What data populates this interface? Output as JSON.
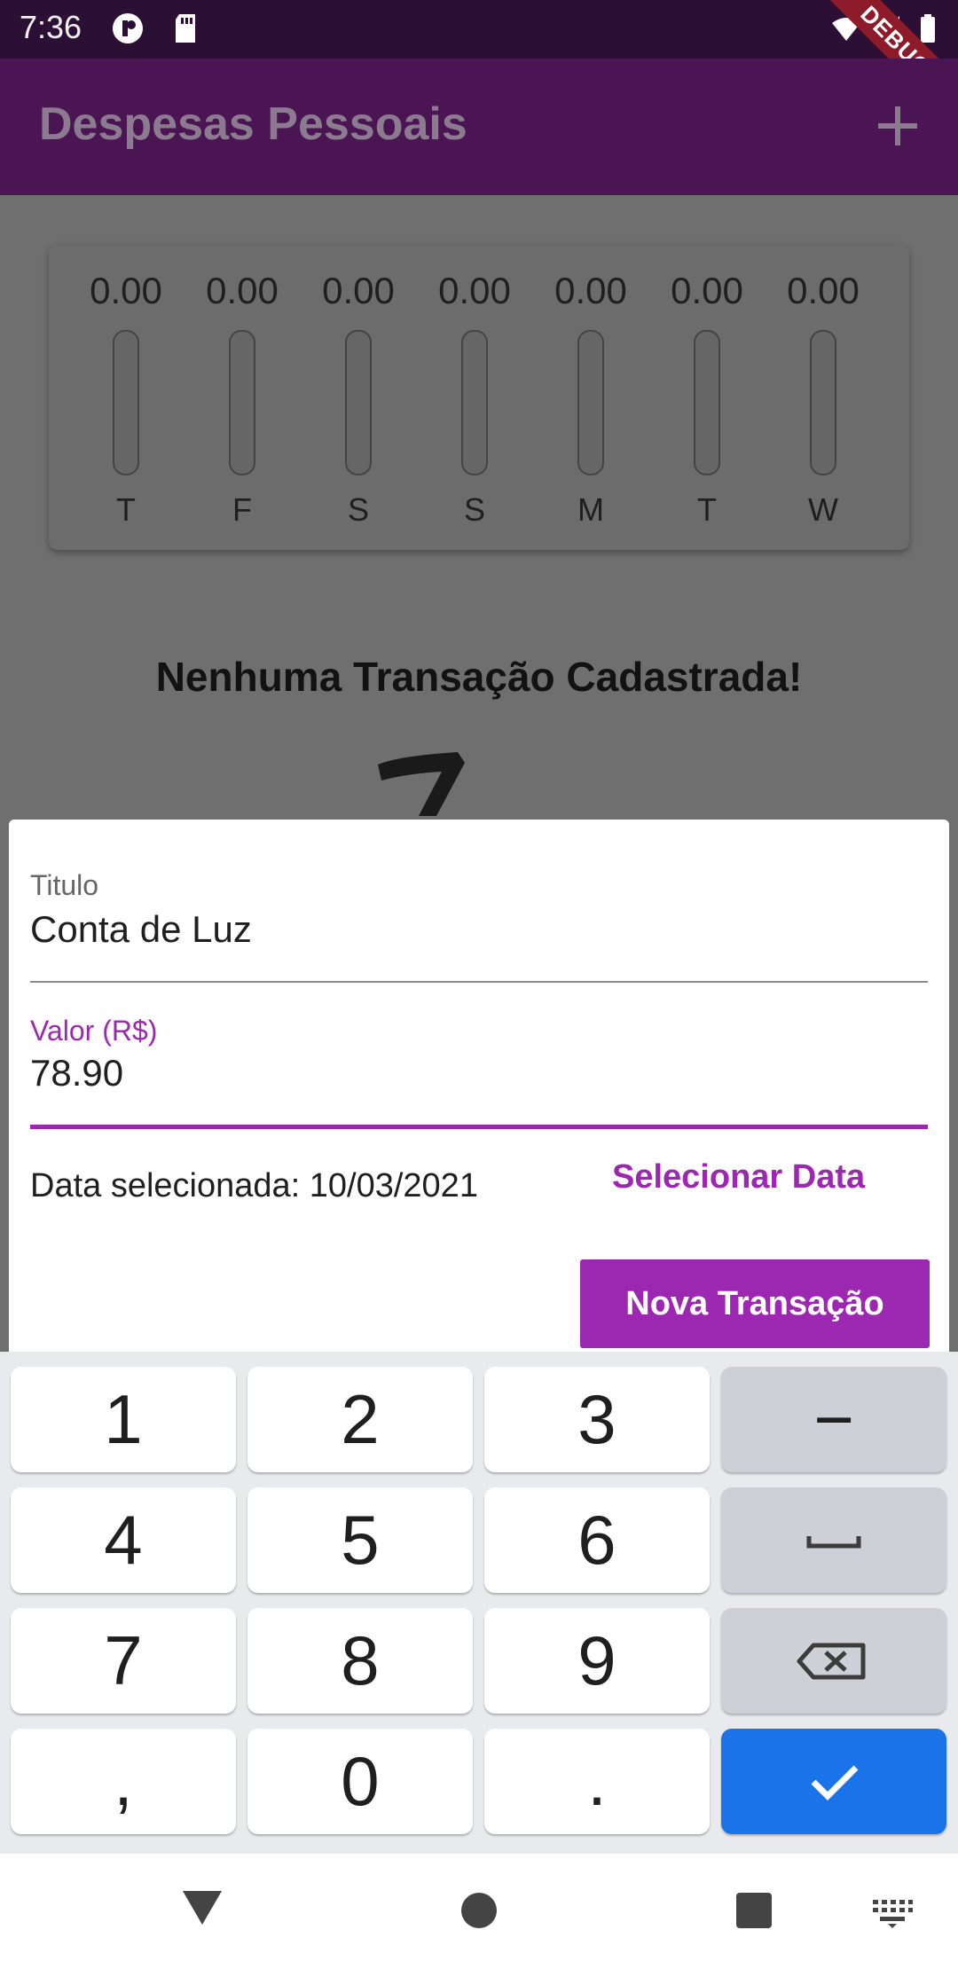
{
  "status_bar": {
    "time": "7:36",
    "debug_label": "DEBUG",
    "icons": [
      "notification-icon",
      "sd-card-icon",
      "wifi-icon",
      "signal-icon",
      "battery-icon"
    ]
  },
  "app_bar": {
    "title": "Despesas Pessoais",
    "add_icon": "plus-icon"
  },
  "chart": {
    "bars": [
      {
        "value": "0.00",
        "day": "T"
      },
      {
        "value": "0.00",
        "day": "F"
      },
      {
        "value": "0.00",
        "day": "S"
      },
      {
        "value": "0.00",
        "day": "S"
      },
      {
        "value": "0.00",
        "day": "M"
      },
      {
        "value": "0.00",
        "day": "T"
      },
      {
        "value": "0.00",
        "day": "W"
      }
    ]
  },
  "empty_state": {
    "title": "Nenhuma Transação Cadastrada!"
  },
  "form": {
    "title_label": "Titulo",
    "title_value": "Conta de Luz",
    "value_label": "Valor (R$)",
    "value_value": "78.90",
    "date_text": "Data selecionada: 10/03/2021",
    "select_date_label": "Selecionar Data",
    "submit_label": "Nova Transação"
  },
  "keyboard": {
    "keys": [
      "1",
      "2",
      "3",
      "−",
      "4",
      "5",
      "6",
      "space",
      "7",
      "8",
      "9",
      "backspace",
      ",",
      "0",
      ".",
      "done"
    ]
  },
  "colors": {
    "primary": "#9c27b0",
    "app_bar": "#4a1552",
    "keyboard_action": "#1a73e8"
  }
}
